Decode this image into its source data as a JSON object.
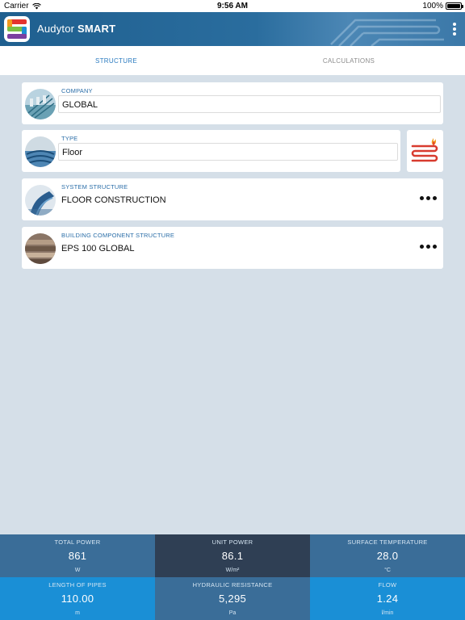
{
  "status_bar": {
    "carrier": "Carrier",
    "time": "9:56 AM",
    "battery": "100%"
  },
  "app": {
    "title_prefix": "Audytor",
    "title_bold": "SMART",
    "icons": {
      "logo": "audytor-s-logo",
      "menu": "kebab-menu-icon"
    }
  },
  "tabs": [
    {
      "label": "STRUCTURE",
      "active": true
    },
    {
      "label": "CALCULATIONS",
      "active": false
    }
  ],
  "cards": {
    "company": {
      "label": "COMPANY",
      "value": "GLOBAL"
    },
    "type": {
      "label": "TYPE",
      "value": "Floor"
    },
    "system_structure": {
      "label": "SYSTEM STRUCTURE",
      "value": "FLOOR CONSTRUCTION"
    },
    "building_component": {
      "label": "BUILDING COMPONENT STRUCTURE",
      "value": "EPS 100 GLOBAL"
    }
  },
  "stats": [
    {
      "label": "TOTAL POWER",
      "value": "861",
      "unit": "W"
    },
    {
      "label": "UNIT POWER",
      "value": "86.1",
      "unit": "W/m²"
    },
    {
      "label": "SURFACE TEMPERATURE",
      "value": "28.0",
      "unit": "°C"
    },
    {
      "label": "LENGTH OF PIPES",
      "value": "110.00",
      "unit": "m"
    },
    {
      "label": "HYDRAULIC RESISTANCE",
      "value": "5,295",
      "unit": "Pa"
    },
    {
      "label": "FLOW",
      "value": "1.24",
      "unit": "l/min"
    }
  ],
  "colors": {
    "header": "#2a6d9e",
    "accent": "#2b7bc0",
    "background": "#d5dfe8",
    "stat_mid": "#3a6d98",
    "stat_dark": "#2f3f54",
    "stat_bright": "#1a8fd6"
  }
}
